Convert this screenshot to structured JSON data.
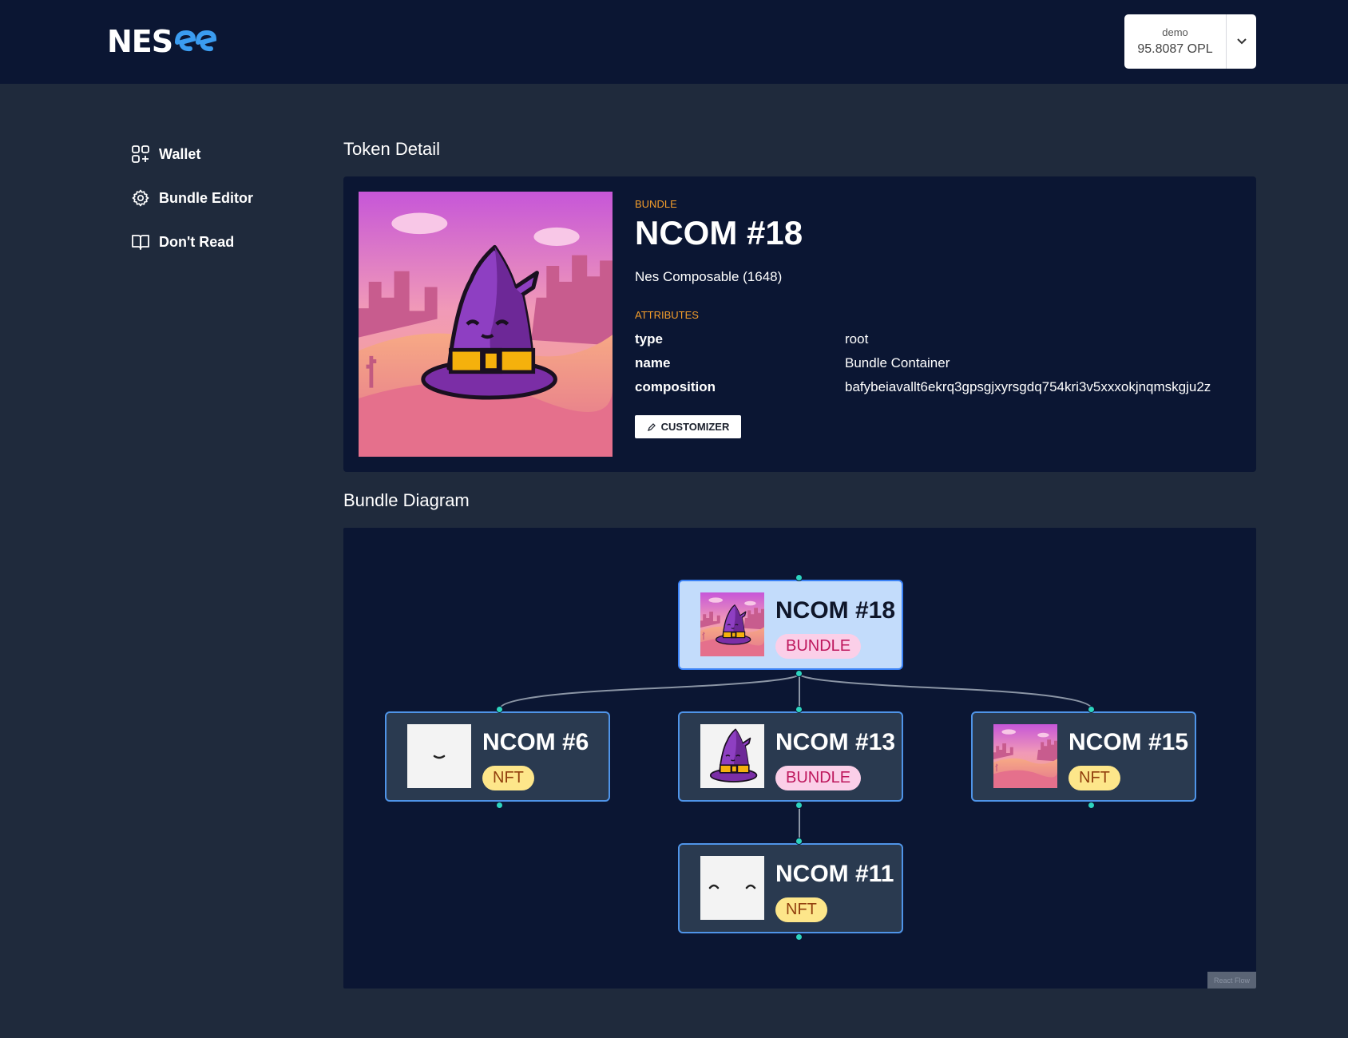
{
  "header": {
    "logo_text": "NES",
    "account": {
      "user": "demo",
      "balance": "95.8087 OPL"
    }
  },
  "sidebar": {
    "items": [
      {
        "label": "Wallet",
        "icon": "wallet-grid-icon"
      },
      {
        "label": "Bundle Editor",
        "icon": "gear-icon"
      },
      {
        "label": "Don't Read",
        "icon": "book-icon"
      }
    ]
  },
  "token_detail": {
    "section_title": "Token Detail",
    "kind": "BUNDLE",
    "title": "NCOM #18",
    "collection": "Nes Composable (1648)",
    "attributes_label": "ATTRIBUTES",
    "attributes": [
      {
        "key": "type",
        "value": "root"
      },
      {
        "key": "name",
        "value": "Bundle Container"
      },
      {
        "key": "composition",
        "value": "bafybeiavallt6ekrq3gpsgjxyrsgdq754kri3v5xxxokjnqmskgju2z"
      }
    ],
    "customizer_label": "CUSTOMIZER"
  },
  "bundle_diagram": {
    "section_title": "Bundle Diagram",
    "nodes": [
      {
        "label": "NCOM #18",
        "badge": "BUNDLE",
        "thumb": "witch-hat-desert",
        "selected": true
      },
      {
        "label": "NCOM #6",
        "badge": "NFT",
        "thumb": "smile-face",
        "selected": false
      },
      {
        "label": "NCOM #13",
        "badge": "BUNDLE",
        "thumb": "witch-hat",
        "selected": false
      },
      {
        "label": "NCOM #15",
        "badge": "NFT",
        "thumb": "desert-sunset",
        "selected": false
      },
      {
        "label": "NCOM #11",
        "badge": "NFT",
        "thumb": "closed-eyes-face",
        "selected": false
      }
    ],
    "attribution": "React Flow"
  },
  "colors": {
    "topbar": "#0b1633",
    "background": "#1f2a3c",
    "card": "#0b1633",
    "accent_orange": "#f59e2b",
    "node_border": "#4f94e8",
    "handle": "#2dd4bf"
  }
}
